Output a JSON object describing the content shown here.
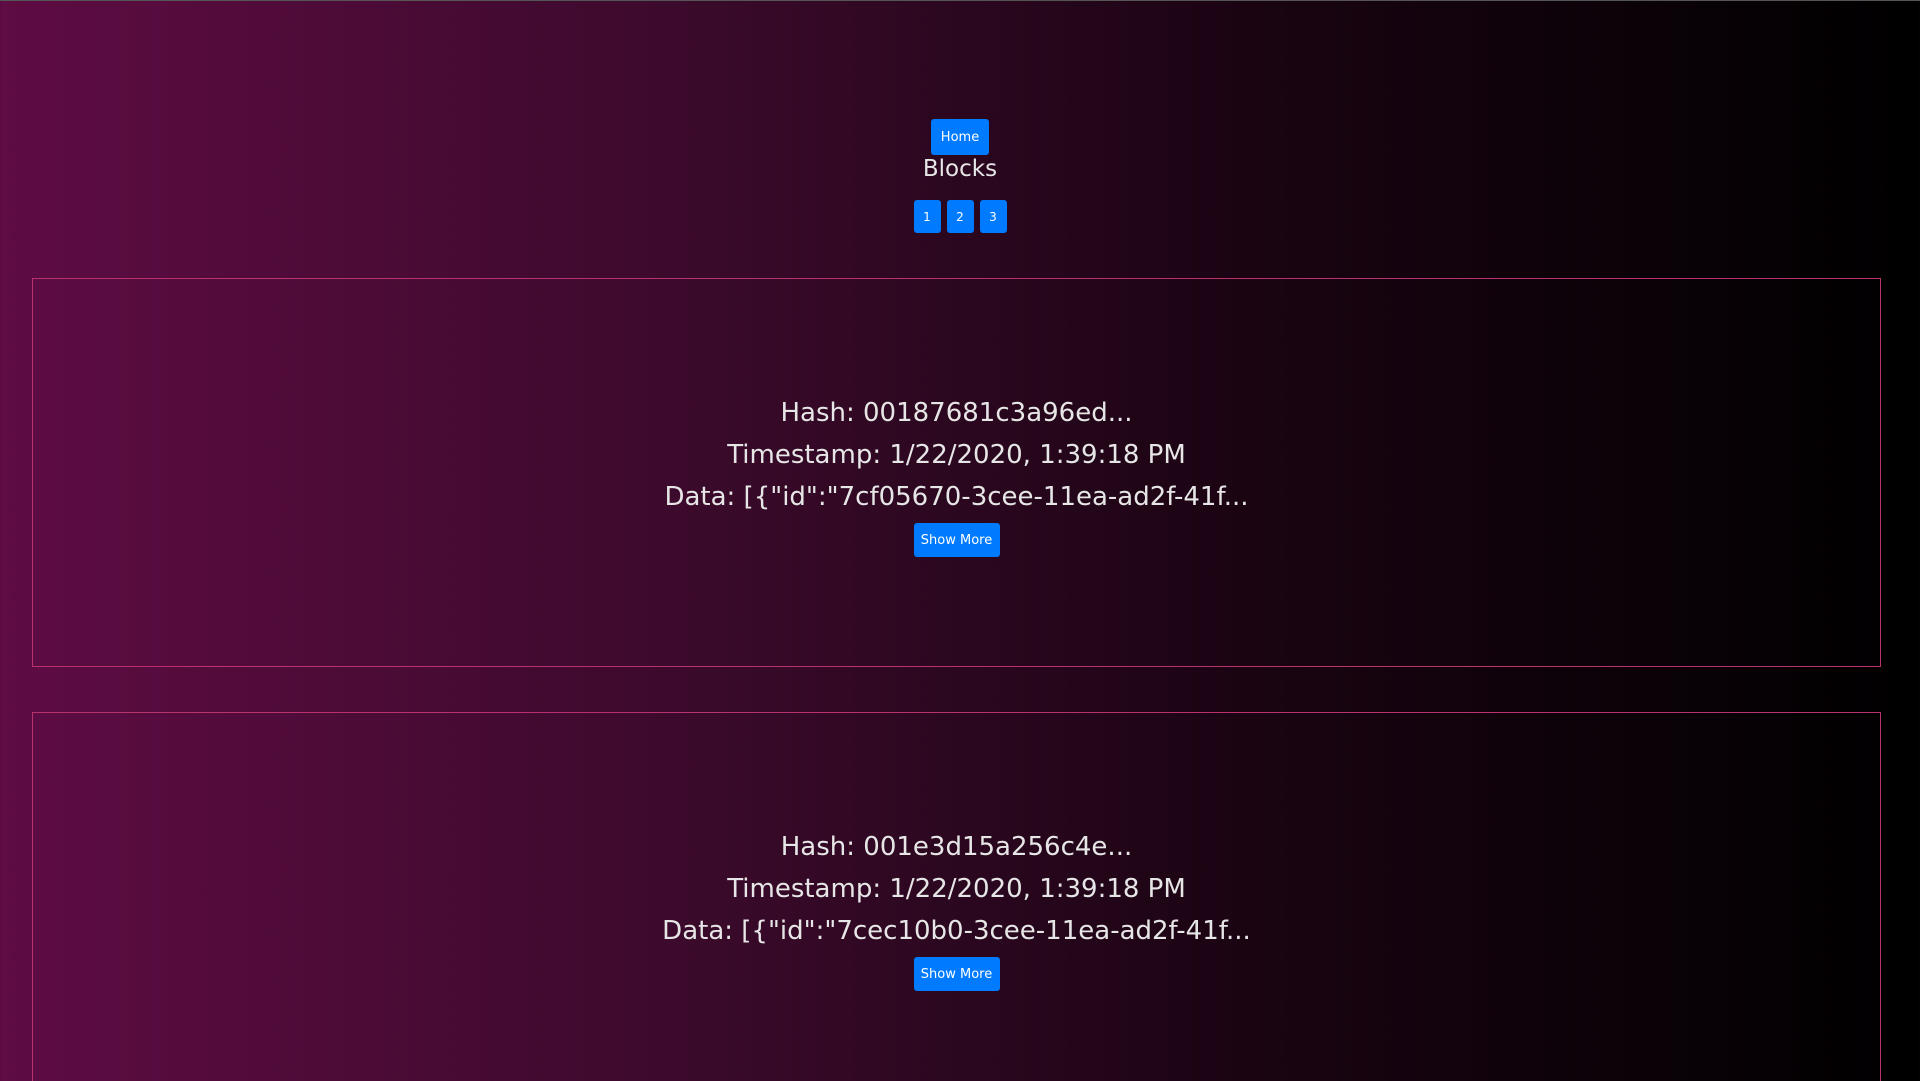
{
  "nav": {
    "home_label": "Home"
  },
  "title": "Blocks",
  "pagination": [
    "1",
    "2",
    "3"
  ],
  "blocks": [
    {
      "hash": "Hash: 00187681c3a96ed...",
      "timestamp": "Timestamp: 1/22/2020, 1:39:18 PM",
      "data": "Data: [{\"id\":\"7cf05670-3cee-11ea-ad2f-41f...",
      "button_label": "Show More"
    },
    {
      "hash": "Hash: 001e3d15a256c4e...",
      "timestamp": "Timestamp: 1/22/2020, 1:39:18 PM",
      "data": "Data: [{\"id\":\"7cec10b0-3cee-11ea-ad2f-41f...",
      "button_label": "Show More"
    }
  ],
  "colors": {
    "button": "#007bff",
    "border": "#b8326e",
    "gradient_start": "#5e0c43",
    "gradient_end": "#000000"
  }
}
